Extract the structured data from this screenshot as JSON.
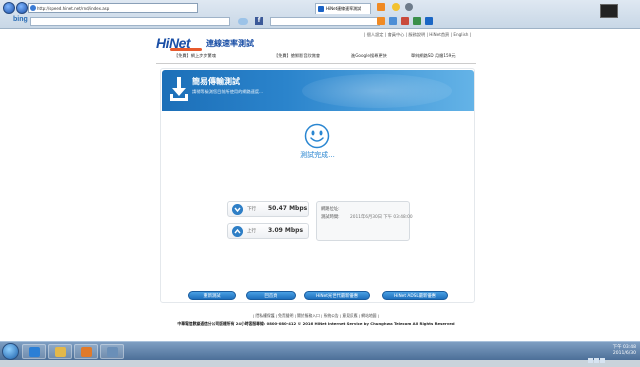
{
  "browser": {
    "address_url": "http://speed.hinet.net/rnd/index.asp",
    "tab_title": "HiNet連線速率測試",
    "search_label": "bing"
  },
  "header": {
    "logo": "HiNet",
    "site_title": "連線速率測試",
    "top_links": "| 個人設定 | 會員中心 | 服務說明 | HiNet首頁 | English |",
    "promos": [
      "【免費】網上步步驚魂",
      "【免費】搶鮮影音欣賞會",
      "進Google搜尋更快",
      "單純網路SD 月繳159元"
    ]
  },
  "banner": {
    "title": "簡易傳輸測試",
    "subtitle": "請稍等檢測您目前所使用的網路速度..."
  },
  "result": {
    "status": "測試完成...",
    "download": {
      "label": "下行",
      "value": "50.47 Mbps"
    },
    "upload": {
      "label": "上行",
      "value": "3.09 Mbps"
    },
    "info": {
      "ip_label": "網路位址:",
      "ip_value": "",
      "time_label": "測試時間:",
      "time_value": "2011年6月30日 下午 03:48:00"
    }
  },
  "buttons": {
    "retest": "重新測試",
    "home": "回首頁",
    "hinet_service": "HiNet光世代最新優惠",
    "adsl": "HiNet ADSL最新優惠"
  },
  "footer": {
    "links": "| 隱私權保護 | 免責聲明 | 關於服務入口 | 系統公告 | 意見反應 | 網站地圖 |",
    "copyright": "中華電信數據通信分公司版權所有 24小時客服專線: 0800-080-412 © 2016 HiNet Internet Service by Chunghwa Telecom All Rights Reserved"
  },
  "taskbar": {
    "time": "下午 03:48",
    "date": "2011/6/30"
  },
  "colors": {
    "accent": "#2a86d1",
    "banner": "#1c6fb8",
    "logo": "#1a4fa6"
  }
}
